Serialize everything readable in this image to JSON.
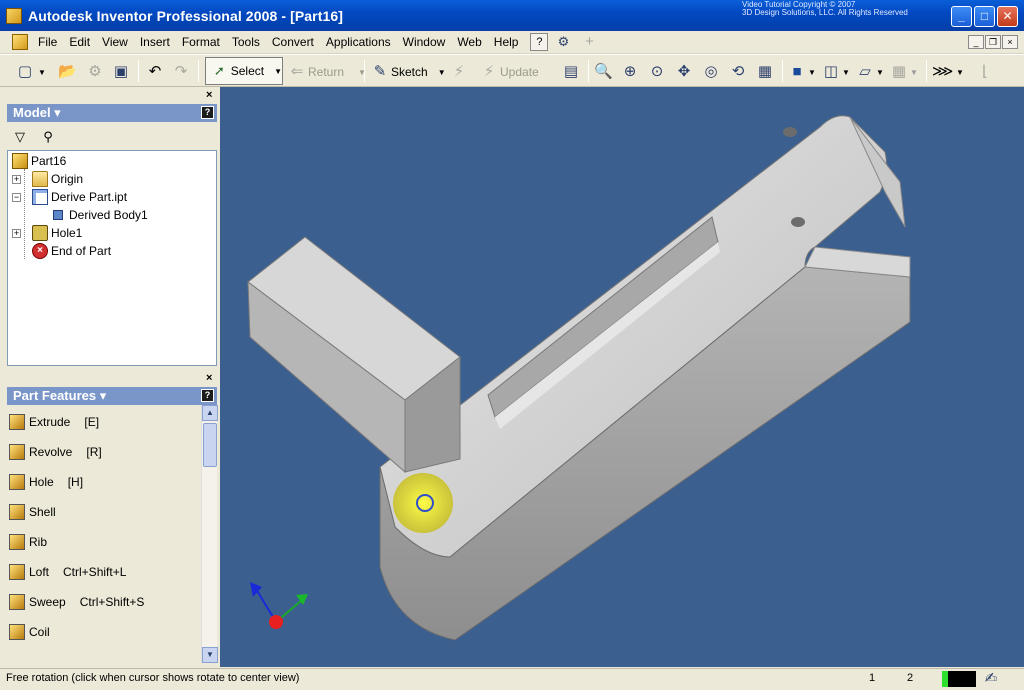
{
  "window": {
    "title": "Autodesk Inventor Professional 2008 - [Part16]",
    "watermark": [
      "Video Tutorial Copyright © 2007",
      "3D Design Solutions, LLC. All Rights Reserved"
    ],
    "minimize": "_",
    "maximize": "□",
    "close": "✕"
  },
  "menu": {
    "items": [
      "File",
      "Edit",
      "View",
      "Insert",
      "Format",
      "Tools",
      "Convert",
      "Applications",
      "Window",
      "Web",
      "Help"
    ],
    "help_icon": "?"
  },
  "toolbar": {
    "select_label": "Select",
    "return_label": "Return",
    "sketch_label": "Sketch",
    "update_label": "Update"
  },
  "model_pane": {
    "header": "Model ▾",
    "close": "×",
    "help": "?",
    "tree": [
      {
        "label": "Part16",
        "icon": "part-icon"
      },
      {
        "label": "Origin",
        "icon": "folder-icon"
      },
      {
        "label": "Derive Part.ipt",
        "icon": "derive-icon"
      },
      {
        "label": "Derived Body1",
        "icon": "body-icon"
      },
      {
        "label": "Hole1",
        "icon": "hole-icon"
      },
      {
        "label": "End of Part",
        "icon": "end-of-part-icon"
      }
    ]
  },
  "features_pane": {
    "header": "Part Features ▾",
    "close": "×",
    "help": "?",
    "items": [
      {
        "label": "Extrude",
        "key": "[E]",
        "icon": "extrude-icon"
      },
      {
        "label": "Revolve",
        "key": "[R]",
        "icon": "revolve-icon"
      },
      {
        "label": "Hole",
        "key": "[H]",
        "icon": "hole-icon"
      },
      {
        "label": "Shell",
        "key": "",
        "icon": "shell-icon"
      },
      {
        "label": "Rib",
        "key": "",
        "icon": "rib-icon"
      },
      {
        "label": "Loft",
        "key": "Ctrl+Shift+L",
        "icon": "loft-icon"
      },
      {
        "label": "Sweep",
        "key": "Ctrl+Shift+S",
        "icon": "sweep-icon"
      },
      {
        "label": "Coil",
        "key": "",
        "icon": "coil-icon"
      }
    ]
  },
  "status": {
    "message": "Free rotation (click when cursor shows rotate to center view)",
    "field1": "1",
    "field2": "2"
  },
  "colors": {
    "viewport_bg": "#3b5f8e",
    "title_bar": "#0349c2",
    "pane_header": "#7a96c8"
  }
}
